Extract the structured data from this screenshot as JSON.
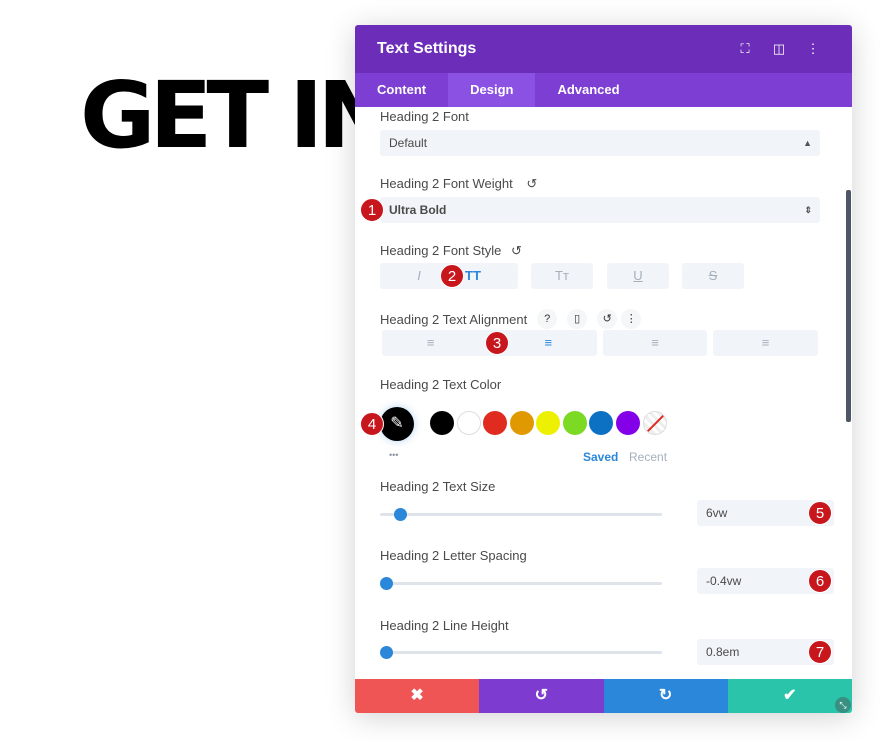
{
  "hero_text": "GET IN",
  "panel": {
    "title": "Text Settings",
    "header_icons": [
      "fullscreen-icon",
      "split-view-icon",
      "more-icon"
    ],
    "tabs": [
      {
        "label": "Content"
      },
      {
        "label": "Design",
        "active": true
      },
      {
        "label": "Advanced"
      }
    ]
  },
  "fields": {
    "font": {
      "label": "Heading 2 Font",
      "value": "Default"
    },
    "weight": {
      "label": "Heading 2 Font Weight",
      "value": "Ultra Bold"
    },
    "style": {
      "label": "Heading 2 Font Style",
      "buttons": [
        "I",
        "TT",
        "Tт",
        "U",
        "S"
      ],
      "active": "TT"
    },
    "align": {
      "label": "Heading 2 Text Alignment",
      "help": "?",
      "active": "center"
    },
    "color": {
      "label": "Heading 2 Text Color",
      "swatches": [
        "#000000",
        "#ffffff",
        "#e02b20",
        "#e09900",
        "#edf000",
        "#7cda24",
        "#0c71c3",
        "#8300e9"
      ],
      "saved": "Saved",
      "recent": "Recent",
      "more": "•••"
    },
    "size": {
      "label": "Heading 2 Text Size",
      "value": "6vw",
      "slider_percent": 7
    },
    "spacing": {
      "label": "Heading 2 Letter Spacing",
      "value": "-0.4vw",
      "slider_percent": 2
    },
    "line_height": {
      "label": "Heading 2 Line Height",
      "value": "0.8em",
      "slider_percent": 2
    }
  },
  "badges": [
    "1",
    "2",
    "3",
    "4",
    "5",
    "6",
    "7"
  ],
  "footer": {
    "cancel": "✖",
    "undo": "↺",
    "redo": "↻",
    "save": "✔",
    "colors": {
      "cancel": "#ef5555",
      "undo": "#7e3bd0",
      "redo": "#2b87da",
      "save": "#29c4a9"
    }
  },
  "accent": "#2b87da"
}
